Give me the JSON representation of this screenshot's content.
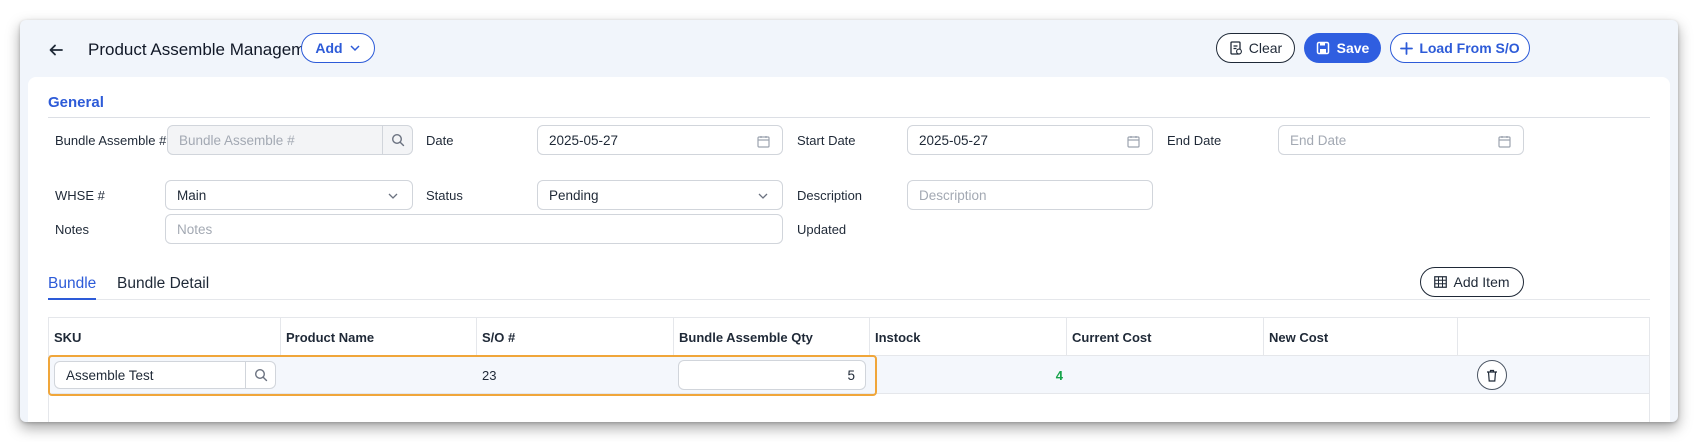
{
  "header": {
    "title": "Product Assemble Management",
    "add_label": "Add",
    "clear_label": "Clear",
    "save_label": "Save",
    "load_label": "Load From S/O"
  },
  "general": {
    "section_title": "General",
    "bundle_assemble": {
      "label": "Bundle Assemble #",
      "value": "",
      "placeholder": "Bundle Assemble #"
    },
    "date": {
      "label": "Date",
      "value": "2025-05-27"
    },
    "start_date": {
      "label": "Start Date",
      "value": "2025-05-27"
    },
    "end_date": {
      "label": "End Date",
      "value": "",
      "placeholder": "End Date"
    },
    "whse": {
      "label": "WHSE #",
      "value": "Main"
    },
    "status": {
      "label": "Status",
      "value": "Pending"
    },
    "description": {
      "label": "Description",
      "value": "",
      "placeholder": "Description"
    },
    "notes": {
      "label": "Notes",
      "value": "",
      "placeholder": "Notes"
    },
    "updated": {
      "label": "Updated",
      "value": ""
    }
  },
  "tabs": [
    {
      "label": "Bundle",
      "active": true
    },
    {
      "label": "Bundle Detail",
      "active": false
    }
  ],
  "add_item_label": "Add Item",
  "table": {
    "columns": [
      "SKU",
      "Product Name",
      "S/O #",
      "Bundle Assemble Qty",
      "Instock",
      "Current Cost",
      "New Cost"
    ],
    "rows": [
      {
        "sku": "Assemble Test",
        "product_name": "",
        "so": "23",
        "qty": "5",
        "instock": "4",
        "current_cost": "",
        "new_cost": ""
      }
    ]
  },
  "colors": {
    "accent": "#2d5bd8",
    "highlight": "#f0a63a",
    "instock": "#16a34a"
  }
}
